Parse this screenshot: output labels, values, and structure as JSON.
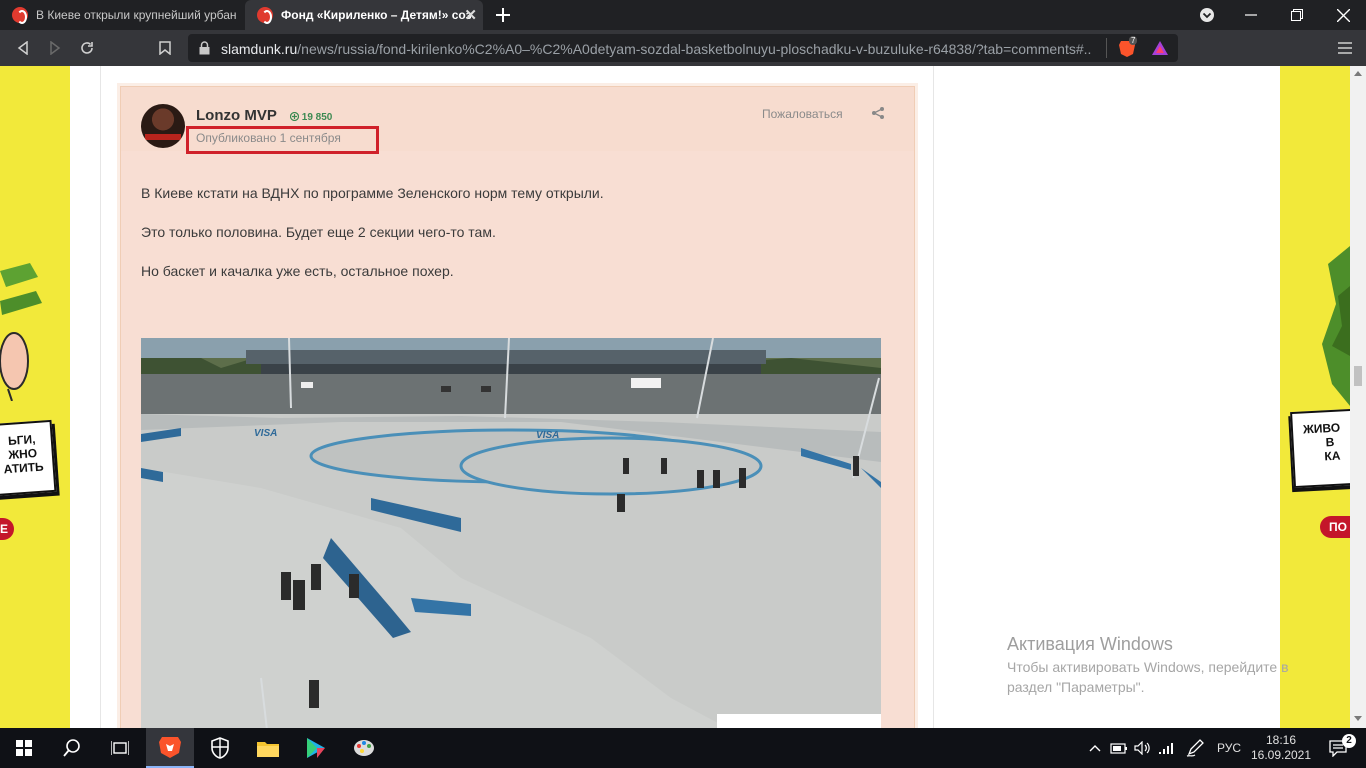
{
  "browser": {
    "tabs": [
      {
        "title": "В Киеве открыли крупнейший урбан",
        "active": false
      },
      {
        "title": "Фонд «Кириленко – Детям!» соз",
        "active": true
      }
    ],
    "new_tab_icon": "plus-icon",
    "url_host": "slamdunk.ru",
    "url_path": "/news/russia/fond-kirilenko%C2%A0–%C2%A0detyam-sozdal-basketbolnuyu-ploschadku-v-buzuluke-r64838/?tab=comments#...",
    "brave_badge": "7"
  },
  "post": {
    "author": "Lonzo MVP",
    "reputation": "19 850",
    "published": "Опубликовано 1 сентября",
    "report_label": "Пожаловаться",
    "paragraphs": [
      "В Киеве кстати на ВДНХ по программе Зеленского норм тему открыли.",
      "Это только половина. Будет еще 2 секции чего-то там.",
      "Но баскет и качалка уже есть, остальное похер."
    ],
    "photo_text": [
      "VISA",
      "VISA"
    ]
  },
  "ads": {
    "left_text": [
      "ЬГИ,",
      "ЖНО",
      "АТИТЬ"
    ],
    "left_button": "Е",
    "right_text": [
      "ЖИВО",
      "В",
      "КА"
    ],
    "right_button": "ПО"
  },
  "watermark": {
    "title": "Активация Windows",
    "subtitle": "Чтобы активировать Windows, перейдите в раздел \"Параметры\"."
  },
  "taskbar": {
    "language": "РУС",
    "time": "18:16",
    "date": "16.09.2021",
    "notification_count": "2"
  },
  "colors": {
    "ad_yellow": "#f2e93a",
    "post_bg": "#f8ded3",
    "highlight_red": "#d0212a",
    "reputation_green": "#3c8a52"
  }
}
